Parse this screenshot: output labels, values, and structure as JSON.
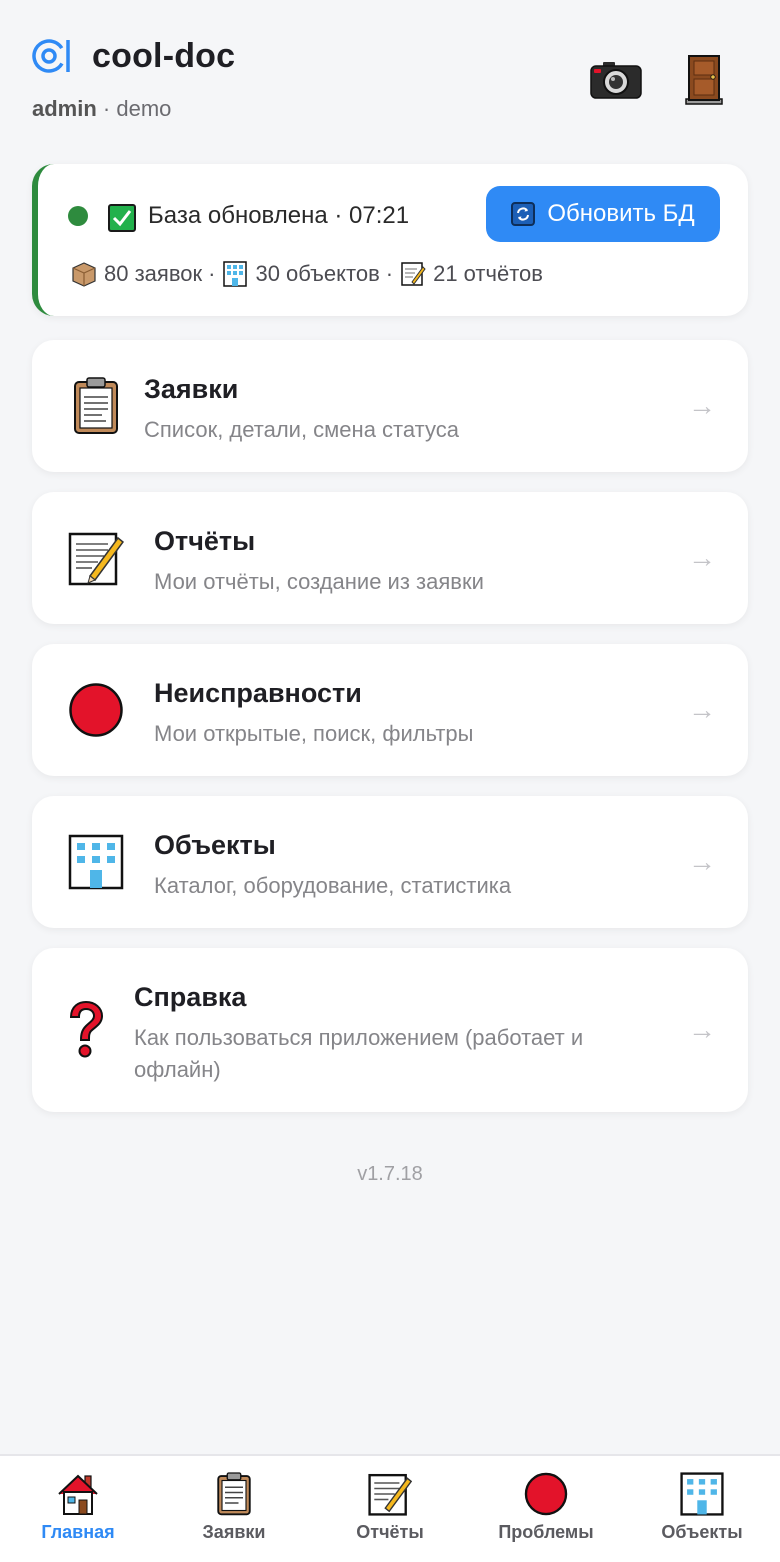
{
  "app": {
    "title": "cool-doc",
    "user": "admin",
    "separator": "·",
    "workspace": "demo"
  },
  "header": {
    "camera_icon": "camera-icon",
    "logout_icon": "door-icon"
  },
  "status": {
    "indicator_color": "#2e8b3e",
    "text": "База обновлена · 07:21",
    "refresh_label": "Обновить БД",
    "stats": [
      {
        "icon": "package-icon",
        "text": "80 заявок"
      },
      {
        "icon": "building-icon",
        "text": "30 объектов"
      },
      {
        "icon": "memo-icon",
        "text": "21 отчётов"
      }
    ],
    "stats_separator": "·"
  },
  "menu": [
    {
      "icon": "clipboard-icon",
      "title": "Заявки",
      "subtitle": "Список, детали, смена статуса",
      "arrow": "→"
    },
    {
      "icon": "memo-icon",
      "title": "Отчёты",
      "subtitle": "Мои отчёты, создание из заявки",
      "arrow": "→"
    },
    {
      "icon": "red-circle-icon",
      "title": "Неисправности",
      "subtitle": "Мои открытые, поиск, фильтры",
      "arrow": "→"
    },
    {
      "icon": "building-icon",
      "title": "Объекты",
      "subtitle": "Каталог, оборудование, статистика",
      "arrow": "→"
    },
    {
      "icon": "question-icon",
      "title": "Справка",
      "subtitle": "Как пользоваться приложением (работает и офлайн)",
      "arrow": "→"
    }
  ],
  "version": "v1.7.18",
  "tabs": [
    {
      "icon": "house-icon",
      "label": "Главная",
      "active": true
    },
    {
      "icon": "clipboard-icon",
      "label": "Заявки",
      "active": false
    },
    {
      "icon": "memo-icon",
      "label": "Отчёты",
      "active": false
    },
    {
      "icon": "red-circle-icon",
      "label": "Проблемы",
      "active": false
    },
    {
      "icon": "building-icon",
      "label": "Объекты",
      "active": false
    }
  ],
  "colors": {
    "accent": "#2f8af5",
    "ok": "#2e8b3e",
    "danger": "#e3132a"
  }
}
